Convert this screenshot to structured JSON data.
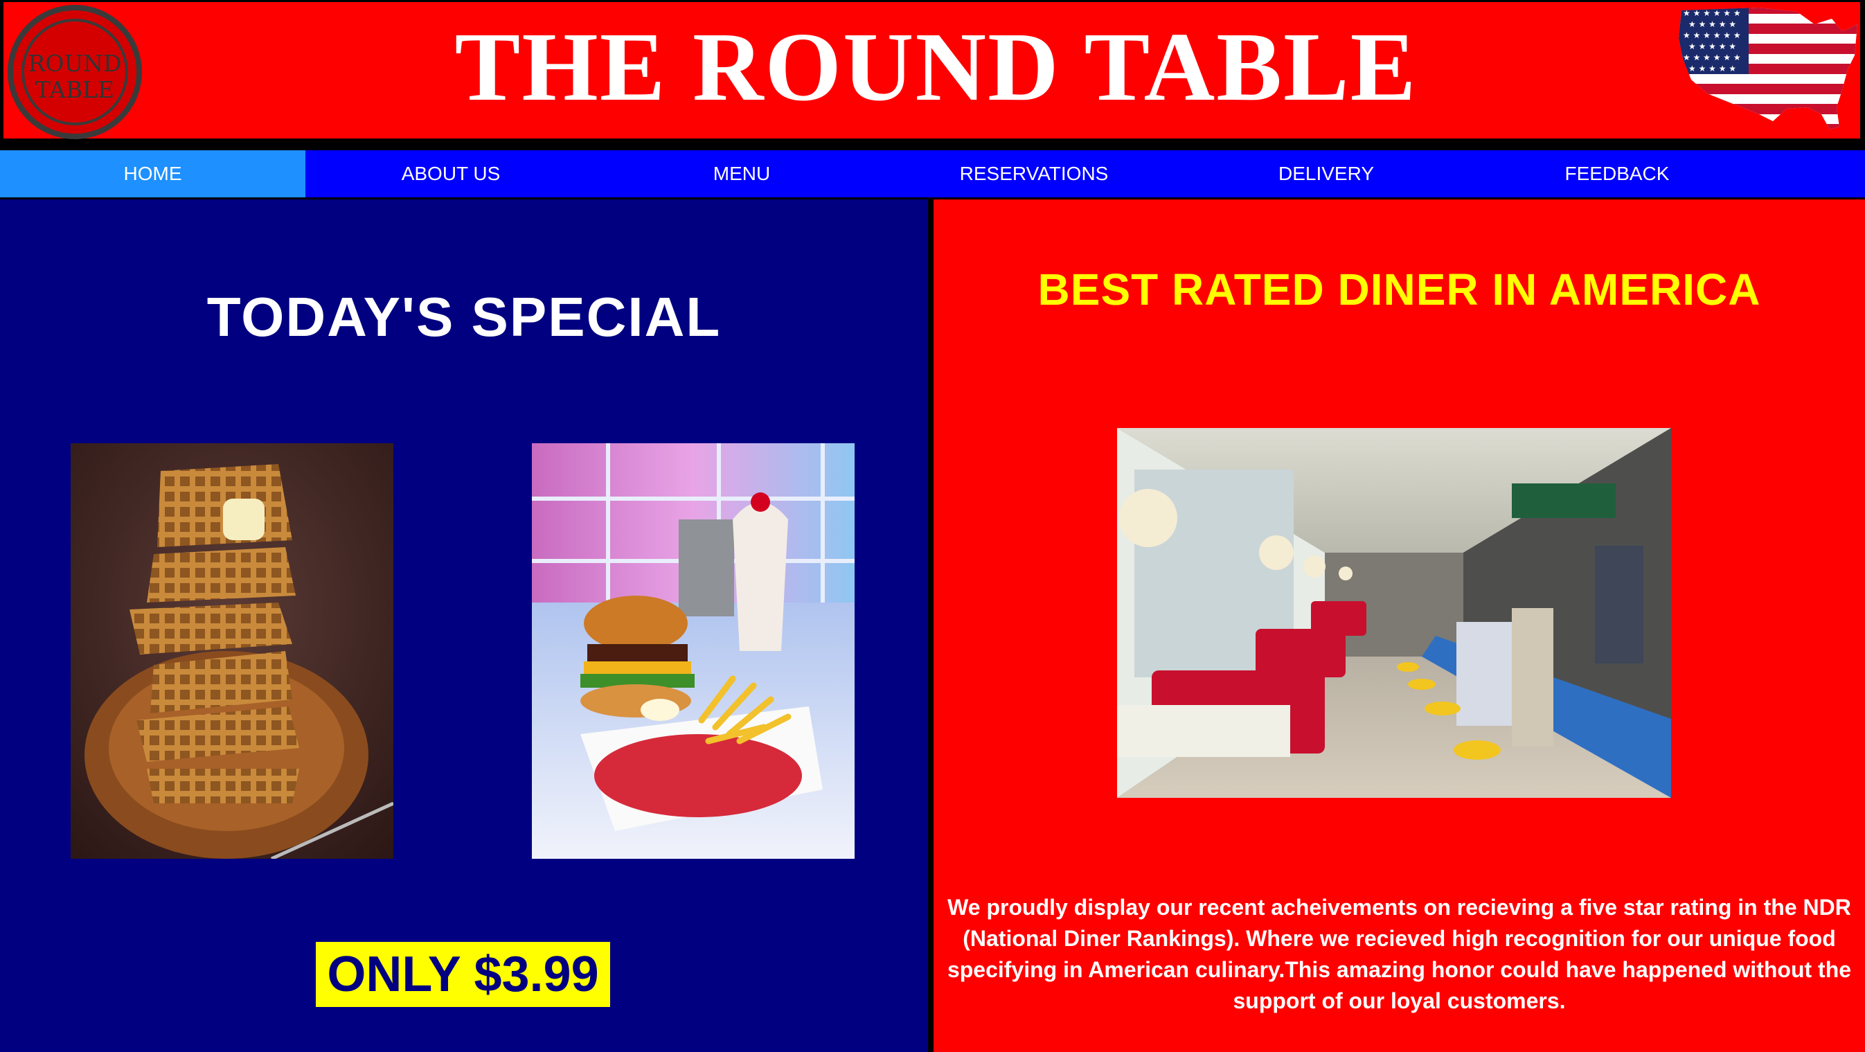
{
  "header": {
    "logo_line1": "ROUND",
    "logo_line2": "TABLE",
    "title": "THE ROUND TABLE",
    "flag_icon": "usa-map-flag-icon"
  },
  "nav": {
    "items": [
      {
        "label": "HOME",
        "active": true
      },
      {
        "label": "ABOUT US",
        "active": false
      },
      {
        "label": "MENU",
        "active": false
      },
      {
        "label": "RESERVATIONS",
        "active": false
      },
      {
        "label": "DELIVERY",
        "active": false
      },
      {
        "label": "FEEDBACK",
        "active": false
      }
    ]
  },
  "special": {
    "title": "TODAY'S SPECIAL",
    "price": "ONLY $3.99",
    "images": [
      "waffle-stack-photo",
      "burger-fries-milkshake-photo"
    ]
  },
  "featured": {
    "title": "BEST RATED DINER IN AMERICA",
    "image": "diner-interior-photo",
    "blurb": "We proudly display our recent acheivements on recieving a five star rating in the NDR (National Diner Rankings). Where we recieved high recognition for our unique food specifying in American culinary.This amazing honor could have happened without the support of our loyal customers."
  },
  "colors": {
    "header_red": "#fe0000",
    "nav_blue": "#0000fe",
    "nav_active": "#1e90ff",
    "left_bg": "#000080",
    "title_yellow": "#ffff00"
  }
}
